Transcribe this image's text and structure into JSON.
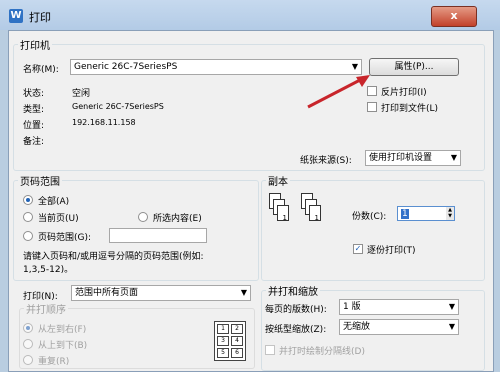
{
  "window": {
    "title": "打印",
    "app_icon": "W",
    "close_glyph": "x"
  },
  "printer": {
    "group_label": "打印机",
    "name_label": "名称(M):",
    "name_value": "Generic 26C-7SeriesPS",
    "properties_button": "属性(P)...",
    "status_label": "状态:",
    "status_value": "空闲",
    "type_label": "类型:",
    "type_value": "Generic 26C-7SeriesPS",
    "location_label": "位置:",
    "location_value": "192.168.11.158",
    "comment_label": "备注:",
    "reverse_print": "反片打印(I)",
    "print_to_file": "打印到文件(L)",
    "paper_source_label": "纸张来源(S):",
    "paper_source_value": "使用打印机设置"
  },
  "page_range": {
    "group_label": "页码范围",
    "all": "全部(A)",
    "current_page": "当前页(U)",
    "selection": "所选内容(E)",
    "pages": "页码范围(G):",
    "hint": "请键入页码和/或用逗号分隔的页码范围(例如:",
    "hint2": "1,3,5-12)。"
  },
  "copies": {
    "group_label": "副本",
    "count_label": "份数(C):",
    "count_value": "1",
    "collate": "逐份打印(T)"
  },
  "print_what": {
    "label": "打印(N):",
    "value": "范围中所有页面"
  },
  "order": {
    "group_label": "并打顺序",
    "left_to_right": "从左到右(F)",
    "top_to_bottom": "从上到下(B)",
    "repeat": "重复(R)",
    "grid": [
      "1",
      "2",
      "3",
      "4",
      "5",
      "6"
    ]
  },
  "zoom": {
    "group_label": "并打和缩放",
    "pages_per_sheet_label": "每页的版数(H):",
    "pages_per_sheet_value": "1 版",
    "scale_label": "按纸型缩放(Z):",
    "scale_value": "无缩放",
    "draw_separator": "并打时绘制分隔线(D)"
  },
  "colors": {
    "accent": "#c8252b"
  }
}
